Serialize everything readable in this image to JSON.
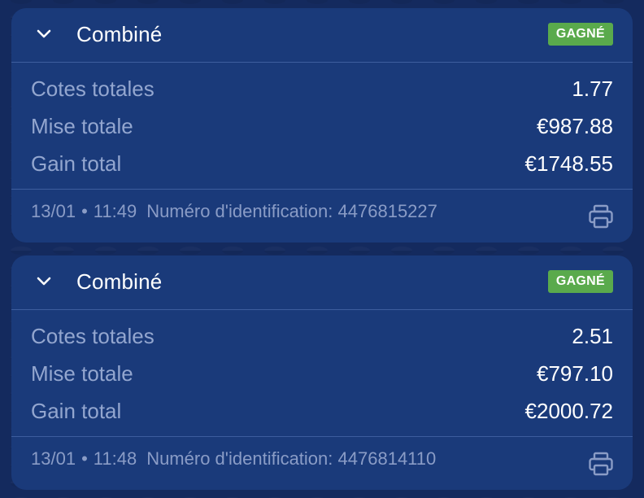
{
  "bets": [
    {
      "title": "Combiné",
      "status": "GAGNÉ",
      "rows": [
        {
          "label": "Cotes totales",
          "value": "1.77"
        },
        {
          "label": "Mise totale",
          "value": "€987.88"
        },
        {
          "label": "Gain total",
          "value": "€1748.55"
        }
      ],
      "date": "13/01",
      "separator": "•",
      "time": "11:49",
      "id_label": "Numéro d'identification:",
      "id_value": "4476815227"
    },
    {
      "title": "Combiné",
      "status": "GAGNÉ",
      "rows": [
        {
          "label": "Cotes totales",
          "value": "2.51"
        },
        {
          "label": "Mise totale",
          "value": "€797.10"
        },
        {
          "label": "Gain total",
          "value": "€2000.72"
        }
      ],
      "date": "13/01",
      "separator": "•",
      "time": "11:48",
      "id_label": "Numéro d'identification:",
      "id_value": "4476814110"
    }
  ],
  "icons": {
    "collapse": "chevron-down-icon",
    "print": "printer-icon"
  },
  "colors": {
    "background": "#142a5e",
    "card": "#1a3a7a",
    "badge_won": "#5aaa4c",
    "label_text": "#93a6cf",
    "value_text": "#ffffff"
  }
}
